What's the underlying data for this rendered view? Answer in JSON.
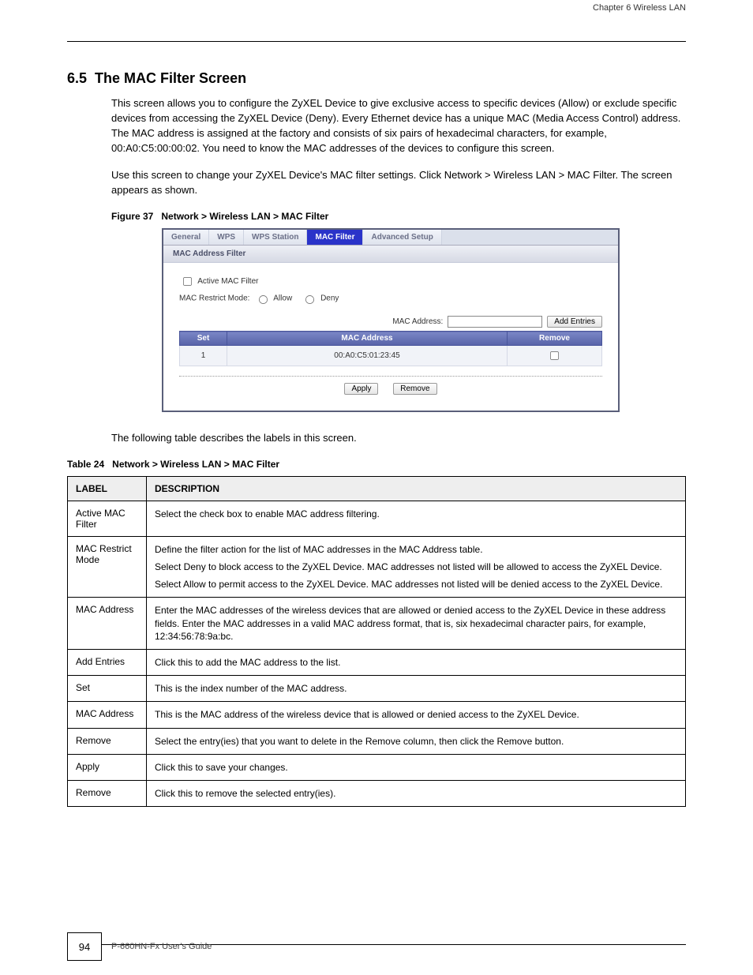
{
  "header": {
    "chapter": "Chapter 6 Wireless LAN"
  },
  "section": {
    "number": "6.5",
    "title": "The MAC Filter Screen",
    "intro": "This screen allows you to configure the ZyXEL Device to give exclusive access to specific devices (Allow) or exclude specific devices from accessing the ZyXEL Device (Deny). Every Ethernet device has a unique MAC (Media Access Control) address. The MAC address is assigned at the factory and consists of six pairs of hexadecimal characters, for example, 00:A0:C5:00:00:02. You need to know the MAC addresses of the devices to configure this screen.",
    "nav": "Use this screen to change your ZyXEL Device's MAC filter settings. Click Network > Wireless LAN > MAC Filter. The screen appears as shown."
  },
  "figure": {
    "label": "Figure 37",
    "caption": "Network > Wireless LAN > MAC Filter"
  },
  "router": {
    "tabs": {
      "general": "General",
      "wps": "WPS",
      "wps_station": "WPS Station",
      "mac_filter": "MAC Filter",
      "advanced": "Advanced Setup"
    },
    "subheader": "MAC Address Filter",
    "active_label": "Active MAC Filter",
    "restrict_label": "MAC Restrict Mode:",
    "allow": "Allow",
    "deny": "Deny",
    "mac_addr_label": "MAC Address:",
    "add_btn": "Add Entries",
    "col_set": "Set",
    "col_mac": "MAC Address",
    "col_remove": "Remove",
    "row1_set": "1",
    "row1_mac": "00:A0:C5:01:23:45",
    "apply": "Apply",
    "remove": "Remove"
  },
  "table_caption": "The following table describes the labels in this screen.",
  "table_title": {
    "label": "Table 24",
    "caption": "Network > Wireless LAN > MAC Filter"
  },
  "table": {
    "head_label": "LABEL",
    "head_desc": "DESCRIPTION",
    "rows": [
      {
        "label": "Active MAC Filter",
        "desc": [
          "Select the check box to enable MAC address filtering."
        ]
      },
      {
        "label": "MAC Restrict Mode",
        "desc": [
          "Define the filter action for the list of MAC addresses in the MAC Address table.",
          "Select Deny to block access to the ZyXEL Device. MAC addresses not listed will be allowed to access the ZyXEL Device.",
          "Select Allow to permit access to the ZyXEL Device. MAC addresses not listed will be denied access to the ZyXEL Device."
        ]
      },
      {
        "label": "MAC Address",
        "desc": [
          "Enter the MAC addresses of the wireless devices that are allowed or denied access to the ZyXEL Device in these address fields. Enter the MAC addresses in a valid MAC address format, that is, six hexadecimal character pairs, for example, 12:34:56:78:9a:bc."
        ]
      },
      {
        "label": "Add Entries",
        "desc": [
          "Click this to add the MAC address to the list."
        ]
      },
      {
        "label": "Set",
        "desc": [
          "This is the index number of the MAC address."
        ]
      },
      {
        "label": "MAC Address",
        "desc": [
          "This is the MAC address of the wireless device that is allowed or denied access to the ZyXEL Device."
        ]
      },
      {
        "label": "Remove",
        "desc": [
          "Select the entry(ies) that you want to delete in the Remove column, then click the Remove button."
        ]
      },
      {
        "label": "Apply",
        "desc": [
          "Click this to save your changes."
        ]
      },
      {
        "label": "Remove",
        "desc": [
          "Click this to remove the selected entry(ies)."
        ]
      }
    ]
  },
  "footer": {
    "page": "94",
    "guide": "P-660HN-Fx User's Guide"
  }
}
